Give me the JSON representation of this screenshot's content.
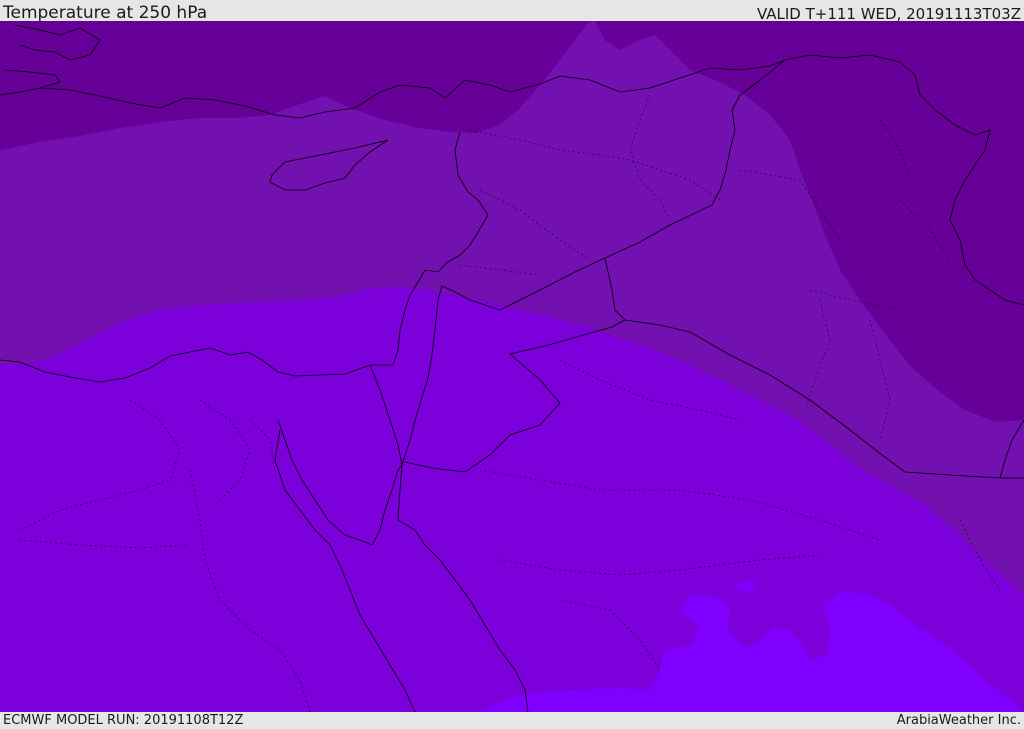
{
  "header": {
    "title": "Temperature at 250 hPa",
    "valid": "VALID T+111 WED, 20191113T03Z"
  },
  "footer": {
    "model_run": "ECMWF MODEL RUN: 20191108T12Z",
    "credit": "ArabiaWeather Inc."
  },
  "map": {
    "colors": {
      "band_coldest": "#660099",
      "band_cold": "#7310b0",
      "band_mid": "#7b00d9",
      "band_warm": "#7f00ff",
      "border": "#000000"
    }
  }
}
